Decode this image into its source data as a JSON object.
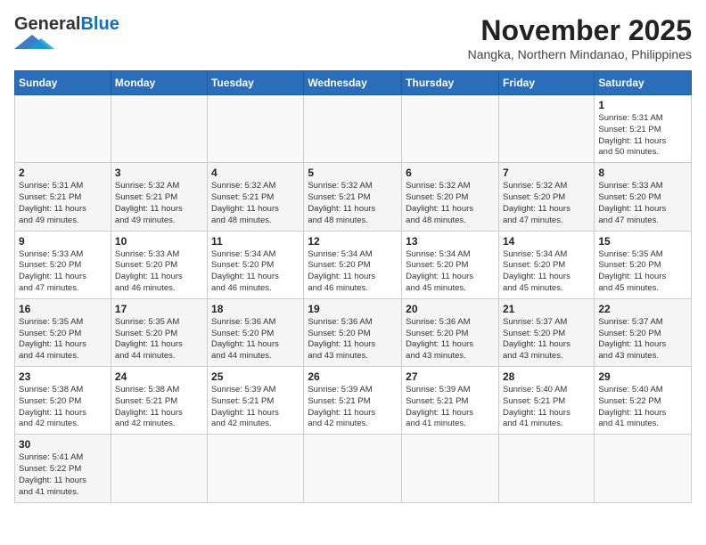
{
  "header": {
    "logo_general": "General",
    "logo_blue": "Blue",
    "month_title": "November 2025",
    "location": "Nangka, Northern Mindanao, Philippines"
  },
  "days_of_week": [
    "Sunday",
    "Monday",
    "Tuesday",
    "Wednesday",
    "Thursday",
    "Friday",
    "Saturday"
  ],
  "weeks": [
    [
      {
        "day": "",
        "content": ""
      },
      {
        "day": "",
        "content": ""
      },
      {
        "day": "",
        "content": ""
      },
      {
        "day": "",
        "content": ""
      },
      {
        "day": "",
        "content": ""
      },
      {
        "day": "",
        "content": ""
      },
      {
        "day": "1",
        "content": "Sunrise: 5:31 AM\nSunset: 5:21 PM\nDaylight: 11 hours\nand 50 minutes."
      }
    ],
    [
      {
        "day": "2",
        "content": "Sunrise: 5:31 AM\nSunset: 5:21 PM\nDaylight: 11 hours\nand 49 minutes."
      },
      {
        "day": "3",
        "content": "Sunrise: 5:32 AM\nSunset: 5:21 PM\nDaylight: 11 hours\nand 49 minutes."
      },
      {
        "day": "4",
        "content": "Sunrise: 5:32 AM\nSunset: 5:21 PM\nDaylight: 11 hours\nand 48 minutes."
      },
      {
        "day": "5",
        "content": "Sunrise: 5:32 AM\nSunset: 5:21 PM\nDaylight: 11 hours\nand 48 minutes."
      },
      {
        "day": "6",
        "content": "Sunrise: 5:32 AM\nSunset: 5:20 PM\nDaylight: 11 hours\nand 48 minutes."
      },
      {
        "day": "7",
        "content": "Sunrise: 5:32 AM\nSunset: 5:20 PM\nDaylight: 11 hours\nand 47 minutes."
      },
      {
        "day": "8",
        "content": "Sunrise: 5:33 AM\nSunset: 5:20 PM\nDaylight: 11 hours\nand 47 minutes."
      }
    ],
    [
      {
        "day": "9",
        "content": "Sunrise: 5:33 AM\nSunset: 5:20 PM\nDaylight: 11 hours\nand 47 minutes."
      },
      {
        "day": "10",
        "content": "Sunrise: 5:33 AM\nSunset: 5:20 PM\nDaylight: 11 hours\nand 46 minutes."
      },
      {
        "day": "11",
        "content": "Sunrise: 5:34 AM\nSunset: 5:20 PM\nDaylight: 11 hours\nand 46 minutes."
      },
      {
        "day": "12",
        "content": "Sunrise: 5:34 AM\nSunset: 5:20 PM\nDaylight: 11 hours\nand 46 minutes."
      },
      {
        "day": "13",
        "content": "Sunrise: 5:34 AM\nSunset: 5:20 PM\nDaylight: 11 hours\nand 45 minutes."
      },
      {
        "day": "14",
        "content": "Sunrise: 5:34 AM\nSunset: 5:20 PM\nDaylight: 11 hours\nand 45 minutes."
      },
      {
        "day": "15",
        "content": "Sunrise: 5:35 AM\nSunset: 5:20 PM\nDaylight: 11 hours\nand 45 minutes."
      }
    ],
    [
      {
        "day": "16",
        "content": "Sunrise: 5:35 AM\nSunset: 5:20 PM\nDaylight: 11 hours\nand 44 minutes."
      },
      {
        "day": "17",
        "content": "Sunrise: 5:35 AM\nSunset: 5:20 PM\nDaylight: 11 hours\nand 44 minutes."
      },
      {
        "day": "18",
        "content": "Sunrise: 5:36 AM\nSunset: 5:20 PM\nDaylight: 11 hours\nand 44 minutes."
      },
      {
        "day": "19",
        "content": "Sunrise: 5:36 AM\nSunset: 5:20 PM\nDaylight: 11 hours\nand 43 minutes."
      },
      {
        "day": "20",
        "content": "Sunrise: 5:36 AM\nSunset: 5:20 PM\nDaylight: 11 hours\nand 43 minutes."
      },
      {
        "day": "21",
        "content": "Sunrise: 5:37 AM\nSunset: 5:20 PM\nDaylight: 11 hours\nand 43 minutes."
      },
      {
        "day": "22",
        "content": "Sunrise: 5:37 AM\nSunset: 5:20 PM\nDaylight: 11 hours\nand 43 minutes."
      }
    ],
    [
      {
        "day": "23",
        "content": "Sunrise: 5:38 AM\nSunset: 5:20 PM\nDaylight: 11 hours\nand 42 minutes."
      },
      {
        "day": "24",
        "content": "Sunrise: 5:38 AM\nSunset: 5:21 PM\nDaylight: 11 hours\nand 42 minutes."
      },
      {
        "day": "25",
        "content": "Sunrise: 5:39 AM\nSunset: 5:21 PM\nDaylight: 11 hours\nand 42 minutes."
      },
      {
        "day": "26",
        "content": "Sunrise: 5:39 AM\nSunset: 5:21 PM\nDaylight: 11 hours\nand 42 minutes."
      },
      {
        "day": "27",
        "content": "Sunrise: 5:39 AM\nSunset: 5:21 PM\nDaylight: 11 hours\nand 41 minutes."
      },
      {
        "day": "28",
        "content": "Sunrise: 5:40 AM\nSunset: 5:21 PM\nDaylight: 11 hours\nand 41 minutes."
      },
      {
        "day": "29",
        "content": "Sunrise: 5:40 AM\nSunset: 5:22 PM\nDaylight: 11 hours\nand 41 minutes."
      }
    ],
    [
      {
        "day": "30",
        "content": "Sunrise: 5:41 AM\nSunset: 5:22 PM\nDaylight: 11 hours\nand 41 minutes."
      },
      {
        "day": "",
        "content": ""
      },
      {
        "day": "",
        "content": ""
      },
      {
        "day": "",
        "content": ""
      },
      {
        "day": "",
        "content": ""
      },
      {
        "day": "",
        "content": ""
      },
      {
        "day": "",
        "content": ""
      }
    ]
  ]
}
